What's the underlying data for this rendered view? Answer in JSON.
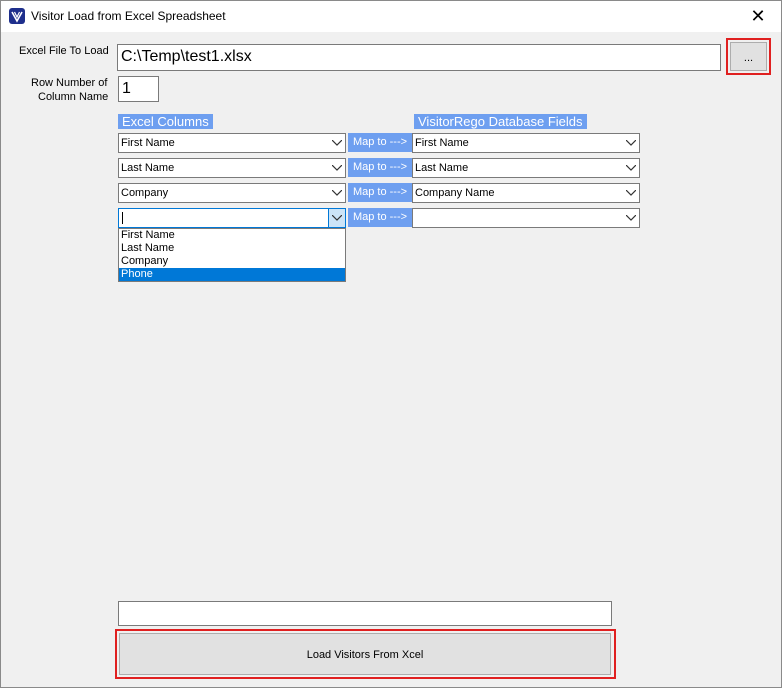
{
  "window": {
    "title": "Visitor Load from Excel Spreadsheet",
    "close_glyph": "✕"
  },
  "form": {
    "excel_file_label": "Excel File To Load",
    "excel_file_value": "C:\\Temp\\test1.xlsx",
    "browse_label": "...",
    "row_number_label_line1": "Row Number of",
    "row_number_label_line2": "Column Name",
    "row_number_value": "1"
  },
  "mapping": {
    "excel_columns_header": "Excel Columns",
    "db_fields_header": "VisitorRego Database Fields",
    "map_label": "Map to --->",
    "rows": [
      {
        "excel": "First Name",
        "db": "First Name"
      },
      {
        "excel": "Last Name",
        "db": "Last Name"
      },
      {
        "excel": "Company",
        "db": "Company Name"
      },
      {
        "excel": "",
        "db": ""
      }
    ],
    "dropdown_options": [
      "First Name",
      "Last Name",
      "Company",
      "Phone"
    ],
    "dropdown_selected": "Phone"
  },
  "footer": {
    "status_value": "",
    "load_button_label": "Load Visitors From Xcel"
  },
  "colors": {
    "accent": "#6e9ff0",
    "highlight_border": "#e02020",
    "selection": "#0078d7"
  }
}
